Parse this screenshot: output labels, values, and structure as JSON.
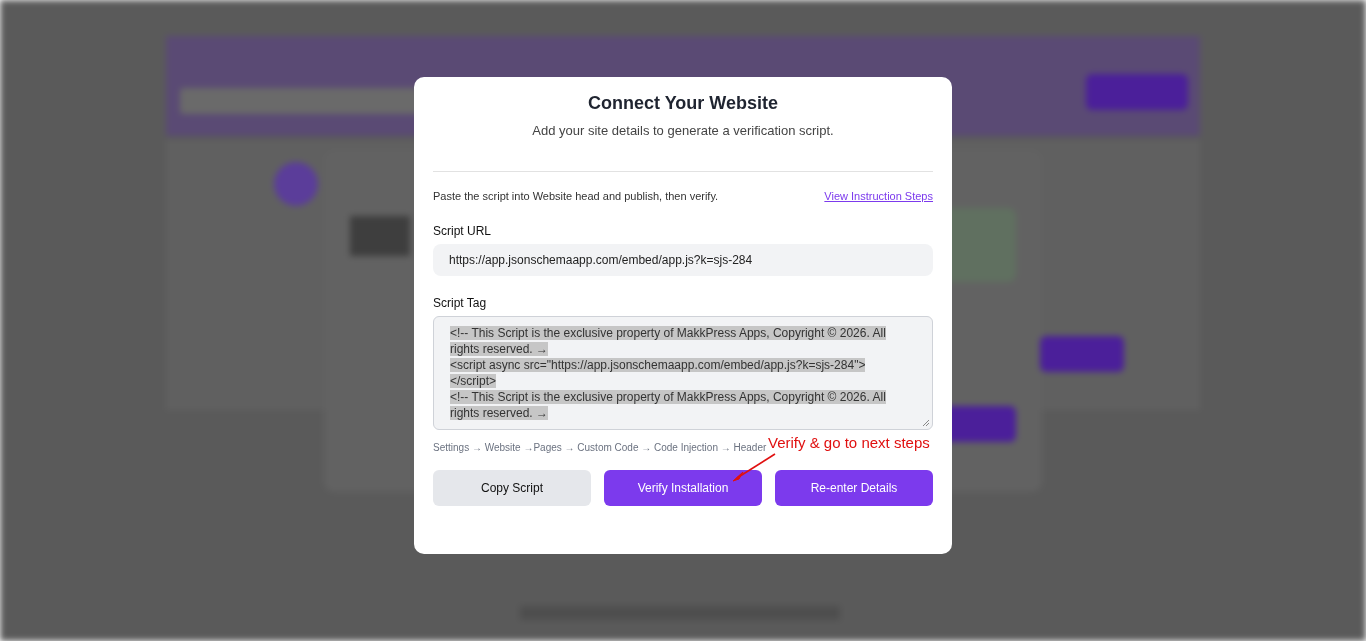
{
  "dialog": {
    "title": "Connect Your Website",
    "subtitle": "Add your site details to generate a verification script.",
    "instruction": "Paste the script into Website head and publish, then verify.",
    "instruction_link": "View Instruction Steps",
    "script_url": {
      "label": "Script URL",
      "value": "https://app.jsonschemaapp.com/embed/app.js?k=sjs-284"
    },
    "script_tag": {
      "label": "Script Tag",
      "selected": true,
      "lines": [
        "<!-- This Script is the exclusive property of MakkPress Apps, Copyright © 2026. All",
        "rights reserved. →",
        "<script async src=\"https://app.jsonschemaapp.com/embed/app.js?k=sjs-284\">",
        "</script>",
        "<!-- This Script is the exclusive property of MakkPress Apps, Copyright © 2026. All",
        "rights reserved. →"
      ]
    },
    "path_hint": "Settings → Website →Pages → Custom Code → Code Injection → Header",
    "annotation": "Verify & go to next steps",
    "buttons": [
      {
        "label": "Copy Script",
        "kind": "secondary"
      },
      {
        "label": "Verify Installation",
        "kind": "primary"
      },
      {
        "label": "Re-enter Details",
        "kind": "primary"
      }
    ]
  }
}
